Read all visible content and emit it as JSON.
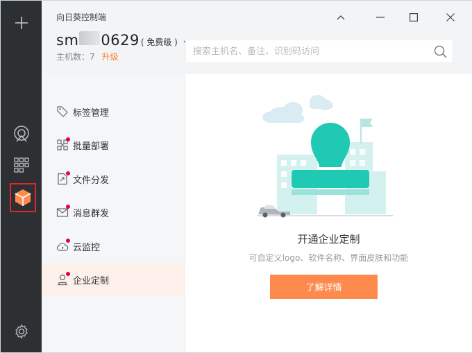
{
  "app": {
    "title": "向日葵控制端"
  },
  "window_controls": {
    "collapse": "collapse",
    "minimize": "minimize",
    "maximize": "maximize",
    "close": "close"
  },
  "account": {
    "name_prefix": "sm",
    "name_suffix": "0629",
    "tier": "( 免费级 )",
    "host_count_label": "主机数：7",
    "upgrade_label": "升级"
  },
  "search": {
    "placeholder": "搜索主机名、备注、识别码访问",
    "value": ""
  },
  "rail": {
    "items": [
      {
        "name": "add",
        "icon": "plus-icon"
      },
      {
        "name": "remote",
        "icon": "remote-icon"
      },
      {
        "name": "apps",
        "icon": "grid-icon"
      },
      {
        "name": "enterprise",
        "icon": "cube-icon",
        "active": true
      },
      {
        "name": "settings",
        "icon": "gear-icon"
      }
    ]
  },
  "menu": {
    "items": [
      {
        "label": "标签管理",
        "icon": "tag-icon",
        "badge": false
      },
      {
        "label": "批量部署",
        "icon": "deploy-icon",
        "badge": true
      },
      {
        "label": "文件分发",
        "icon": "file-share-icon",
        "badge": true
      },
      {
        "label": "消息群发",
        "icon": "mail-icon",
        "badge": true
      },
      {
        "label": "云监控",
        "icon": "cloud-monitor-icon",
        "badge": true
      },
      {
        "label": "企业定制",
        "icon": "custom-user-icon",
        "badge": true,
        "active": true
      }
    ]
  },
  "promo": {
    "title": "开通企业定制",
    "subtitle": "可自定义logo、软件名称、界面皮肤和功能",
    "button_label": "了解详情"
  },
  "colors": {
    "rail": "#2d3033",
    "accent": "#ff8a4e",
    "upgrade": "#ff7d2b",
    "active_outline": "#e0262b",
    "badge": "#e4004f",
    "illustration_teal": "#20c9b3"
  }
}
